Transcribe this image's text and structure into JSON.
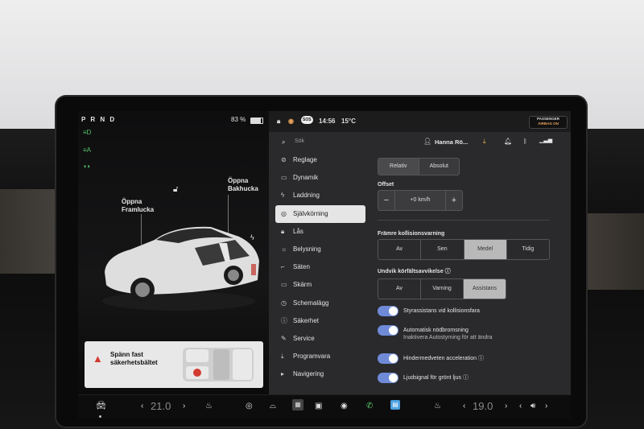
{
  "status": {
    "gear": "P R N D",
    "battery_pct": "83 %",
    "battery_level": 0.83,
    "time": "14:56",
    "temp": "15°C",
    "sos": "SOS",
    "airbag_line1": "PASSENGER",
    "airbag_line2": "AIRBAG ON"
  },
  "car_view": {
    "frunk_label": "Öppna Framlucka",
    "trunk_label": "Öppna Bakhucka",
    "warning_text": "Spänn fast säkerhetsbältet"
  },
  "search": {
    "placeholder": "Sök",
    "profile_name": "Hanna Rö..."
  },
  "menu": [
    {
      "label": "Reglage",
      "icon": "toggle-icon"
    },
    {
      "label": "Dynamik",
      "icon": "car-icon"
    },
    {
      "label": "Laddning",
      "icon": "bolt-icon"
    },
    {
      "label": "Självkörning",
      "icon": "steering-wheel-icon"
    },
    {
      "label": "Lås",
      "icon": "lock-icon"
    },
    {
      "label": "Belysning",
      "icon": "sun-icon"
    },
    {
      "label": "Säten",
      "icon": "seat-icon"
    },
    {
      "label": "Skärm",
      "icon": "display-icon"
    },
    {
      "label": "Schemalägg",
      "icon": "clock-icon"
    },
    {
      "label": "Säkerhet",
      "icon": "info-icon"
    },
    {
      "label": "Service",
      "icon": "wrench-icon"
    },
    {
      "label": "Programvara",
      "icon": "download-icon"
    },
    {
      "label": "Navigering",
      "icon": "navigation-icon"
    }
  ],
  "settings": {
    "mode_tabs": [
      "Relativ",
      "Absolut"
    ],
    "offset_label": "Offset",
    "offset_value": "+0 km/h",
    "minus": "−",
    "plus": "+",
    "fcw_label": "Främre kollisionsvarning",
    "fcw_options": [
      "Av",
      "Sen",
      "Medel",
      "Tidig"
    ],
    "fcw_selected": "Medel",
    "lda_label": "Undvik körfältsavvikelse",
    "lda_options": [
      "Av",
      "Varning",
      "Assistans"
    ],
    "lda_selected": "Assistans",
    "toggles": [
      {
        "label": "Styrassistans vid kollisionsfara",
        "sub": "",
        "on": true
      },
      {
        "label": "Automatisk nödbromsning",
        "sub": "Inaktivera Autostyrning för att ändra",
        "on": true
      },
      {
        "label": "Hindermedveten acceleration",
        "sub": "",
        "on": true
      },
      {
        "label": "Ljudsignal för grönt ljus",
        "sub": "",
        "on": true
      }
    ]
  },
  "bottom_bar": {
    "left_temp": "21.0",
    "right_temp": "19.0"
  },
  "colors": {
    "accent": "#6f8bd8",
    "indicator_green": "#56c56a",
    "warning_red": "#d23b30"
  }
}
